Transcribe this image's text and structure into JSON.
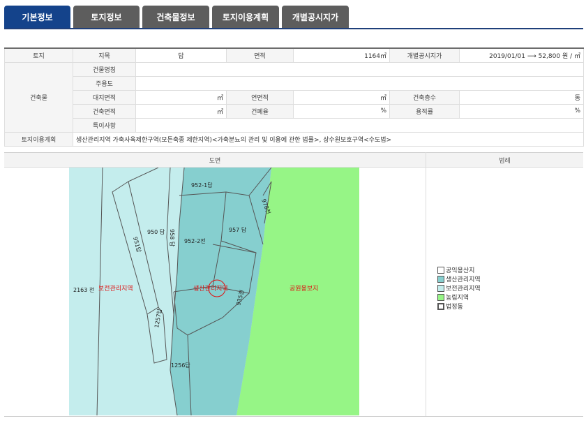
{
  "tabs": [
    {
      "label": "기본정보",
      "active": true
    },
    {
      "label": "토지정보",
      "active": false
    },
    {
      "label": "건축물정보",
      "active": false
    },
    {
      "label": "토지이용계획",
      "active": false
    },
    {
      "label": "개별공시지가",
      "active": false
    }
  ],
  "info": {
    "land_header": "토지",
    "jimok_label": "지목",
    "jimok_value": "답",
    "area_label": "면적",
    "area_value": "1164㎡",
    "price_label": "개별공시지가",
    "price_value": "2019/01/01 ⟶ 52,800 원 / ㎡",
    "building_header": "건축물",
    "building_name_label": "건물명칭",
    "main_use_label": "주용도",
    "site_area_label": "대지면적",
    "site_area_unit": "㎡",
    "floor_area_label": "연면적",
    "floor_area_unit": "㎡",
    "floors_label": "건축층수",
    "floors_unit": "동",
    "building_area_label": "건축면적",
    "building_area_unit": "㎡",
    "coverage_label": "건폐율",
    "coverage_unit": "%",
    "far_label": "용적률",
    "far_unit": "%",
    "special_label": "특이사항",
    "plan_label": "토지이용계획",
    "plan_value": "생산관리지역 가축사육제한구역(모든축종 제한지역)<가축분뇨의 관리 및 이용에 관한 법률>, 상수원보호구역<수도법>"
  },
  "panel": {
    "drawing_header": "도면",
    "legend_header": "범례"
  },
  "map": {
    "colors": {
      "production": "#86cfcf",
      "conservation": "#c4eded",
      "agri": "#96f586",
      "border": "#555555"
    },
    "parcel_labels": {
      "p952_1": "952-1답",
      "p950": "950 답",
      "p951": "951답",
      "p952_2": "952-2전",
      "p957": "957 답",
      "p958": "958 답",
      "p978": "978천",
      "p2163": "2163 천",
      "p1257": "1257답",
      "p1256": "1256답",
      "p935": "935전"
    },
    "zone_labels": {
      "conservation": "보전관리지역",
      "production": "생산관리지역",
      "public": "공원용보지"
    }
  },
  "legend": [
    {
      "label": "공익용산지",
      "color": "#ffffff"
    },
    {
      "label": "생산관리지역",
      "color": "#86cfcf"
    },
    {
      "label": "보전관리지역",
      "color": "#c4eded"
    },
    {
      "label": "농림지역",
      "color": "#96f586"
    },
    {
      "label": "법정동",
      "color": "#ffffff"
    }
  ]
}
